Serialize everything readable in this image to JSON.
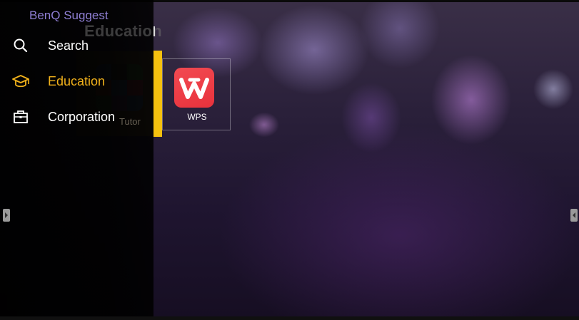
{
  "header": {
    "brand": "BenQ Suggest",
    "section_title": "Education"
  },
  "sidebar": {
    "items": [
      {
        "label": "Search",
        "icon": "search-icon",
        "active": false
      },
      {
        "label": "Education",
        "icon": "graduation-cap-icon",
        "active": true
      },
      {
        "label": "Corporation",
        "icon": "briefcase-icon",
        "active": false
      }
    ]
  },
  "apps": [
    {
      "label": "Tutor",
      "icon": "math-tutor-icon",
      "partially_hidden": true
    },
    {
      "label": "WPS",
      "icon": "wps-office-icon",
      "focused": true
    }
  ],
  "colors": {
    "accent": "#f2b21b",
    "brand": "#8f7fd4",
    "wps_red": "#e8323c"
  }
}
